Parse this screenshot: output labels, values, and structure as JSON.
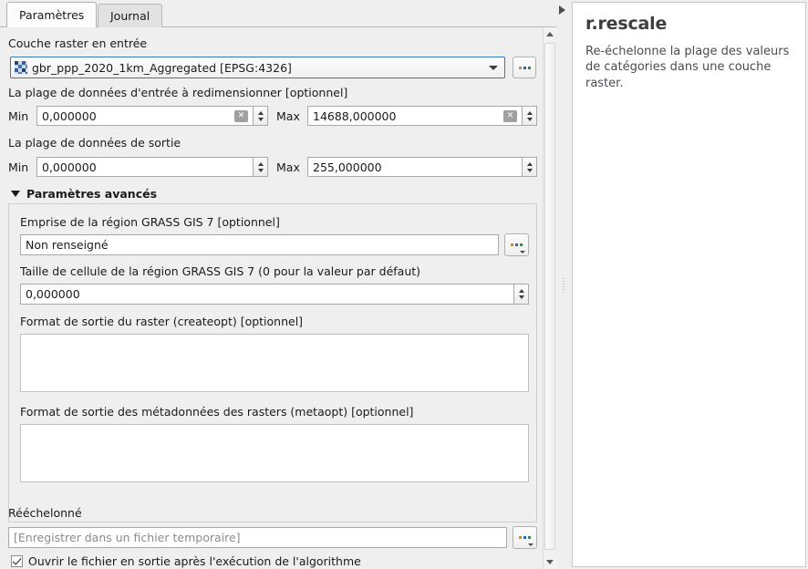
{
  "window": {
    "tabs": [
      {
        "label": "Paramètres",
        "selected": true
      },
      {
        "label": "Journal",
        "selected": false
      }
    ]
  },
  "parameters": {
    "input_layer": {
      "label": "Couche raster en entrée",
      "value": "gbr_ppp_2020_1km_Aggregated [EPSG:4326]",
      "icon": "raster-layer-icon",
      "browse_label": "...",
      "dropdown_icon": "chevron-down-icon"
    },
    "input_range": {
      "label": "La plage de données d'entrée à redimensionner [optionnel]",
      "min_label": "Min",
      "min_value": "0,000000",
      "max_label": "Max",
      "max_value": "14688,000000",
      "clear_icon": "clear-icon"
    },
    "output_range": {
      "label": "La plage de données de sortie",
      "min_label": "Min",
      "min_value": "0,000000",
      "max_label": "Max",
      "max_value": "255,000000"
    },
    "advanced": {
      "title": "Paramètres avancés",
      "expanded": true,
      "collapse_icon": "triangle-down-icon",
      "region_extent": {
        "label": "Emprise de la région GRASS GIS 7 [optionnel]",
        "value": "Non renseigné",
        "browse_label": "..."
      },
      "cell_size": {
        "label": "Taille de cellule de la région GRASS GIS 7 (0 pour la valeur par défaut)",
        "value": "0,000000"
      },
      "createopt": {
        "label": "Format de sortie du raster (createopt) [optionnel]",
        "value": ""
      },
      "metaopt": {
        "label": "Format de sortie des métadonnées des rasters (metaopt) [optionnel]",
        "value": ""
      }
    },
    "output": {
      "label": "Rééchelonné",
      "value": "",
      "placeholder": "[Enregistrer dans un fichier temporaire]",
      "browse_label": "..."
    },
    "open_output": {
      "label": "Ouvrir le fichier en sortie après l'exécution de l'algorithme",
      "checked": true
    }
  },
  "help_panel": {
    "title": "r.rescale",
    "description": "Re-échelonne la plage des valeurs de catégories dans une couche raster."
  },
  "scrollbar": {
    "up_icon": "scroll-up-icon",
    "down_icon": "scroll-down-icon"
  },
  "splitter": {
    "collapse_icon": "splitter-collapse-icon"
  },
  "colors": {
    "background": "#efefef",
    "panel": "#ffffff",
    "focus_border": "#3a7ab4",
    "text": "#1a1a1a",
    "muted_text": "#8b8b8b"
  }
}
